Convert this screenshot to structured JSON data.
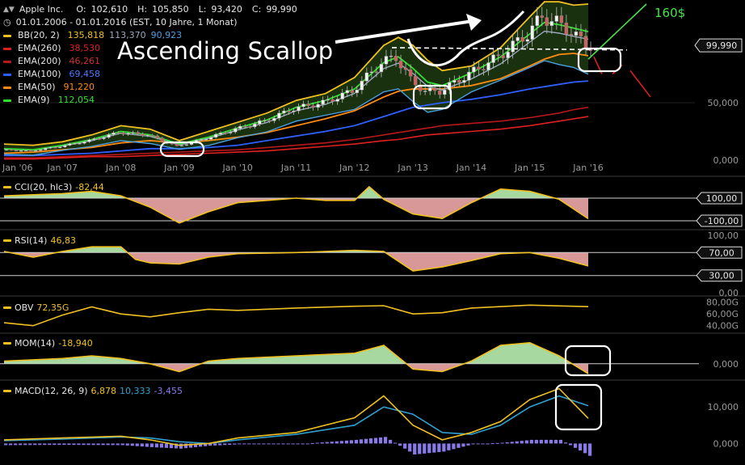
{
  "header": {
    "symbol": "Apple Inc.",
    "ohlc": [
      {
        "label": "O:",
        "value": "102,610"
      },
      {
        "label": "H:",
        "value": "105,850"
      },
      {
        "label": "L:",
        "value": "93,420"
      },
      {
        "label": "C:",
        "value": "99,990"
      }
    ],
    "period": "01.01.2006 - 01.01.2016 (EST, 10 Jahre, 1 Monat)",
    "indicators": [
      {
        "name": "BB(20, 2)",
        "values": [
          "135,818",
          "113,370",
          "90,923"
        ],
        "color": "#f0c020",
        "value_colors": [
          "#f0c020",
          "#9aa8c0",
          "#4aa0e0"
        ]
      },
      {
        "name": "EMA(260)",
        "values": [
          "38,530"
        ],
        "color": "#e02020"
      },
      {
        "name": "EMA(200)",
        "values": [
          "46,261"
        ],
        "color": "#b81818"
      },
      {
        "name": "EMA(100)",
        "values": [
          "69,458"
        ],
        "color": "#2f5fff"
      },
      {
        "name": "EMA(50)",
        "values": [
          "91,220"
        ],
        "color": "#ff8c10"
      },
      {
        "name": "EMA(9)",
        "values": [
          "112,054"
        ],
        "color": "#30e030"
      }
    ]
  },
  "annotations": {
    "pattern": "Ascending Scallop",
    "target": "160$",
    "price_tag": "99,990"
  },
  "colors": {
    "background": "#000000",
    "bb_band": "#f0c020",
    "bb_fill": "#1f3a12",
    "bb_mid": "#9aa8c0",
    "ema9": "#30e030",
    "ema50": "#ff8c10",
    "ema100": "#2f5fff",
    "ema200": "#b81818",
    "ema260": "#e02020",
    "bb_lower": "#4aa0e0",
    "osc_line": "#f0c020",
    "osc_pos_fill": "#b8f0b0",
    "osc_neg_fill": "#f0a8a8",
    "macd_signal": "#30a0d0",
    "macd_hist": "#8a7ae8",
    "trend_green": "#49e04a",
    "trend_red": "#e02020"
  },
  "chart_data": [
    {
      "type": "line",
      "title": "Apple Inc.",
      "panel": "price",
      "x_ticks": [
        "Jan '06",
        "Jan '07",
        "Jan '08",
        "Jan '09",
        "Jan '10",
        "Jan '11",
        "Jan '12",
        "Jan '13",
        "Jan '14",
        "Jan '15",
        "Jan '16"
      ],
      "y_ticks": [
        "50,000",
        "0,000"
      ],
      "ylim": [
        0,
        140
      ],
      "x": [
        2006.0,
        2006.5,
        2007.0,
        2007.5,
        2008.0,
        2008.5,
        2009.0,
        2009.5,
        2010.0,
        2010.5,
        2011.0,
        2011.5,
        2012.0,
        2012.5,
        2012.75,
        2013.0,
        2013.25,
        2013.5,
        2014.0,
        2014.5,
        2015.0,
        2015.25,
        2015.5,
        2015.75,
        2016.0
      ],
      "series": [
        {
          "name": "Price",
          "values": [
            9,
            8,
            12,
            17,
            24,
            22,
            12,
            19,
            27,
            34,
            45,
            50,
            60,
            85,
            90,
            70,
            60,
            60,
            75,
            90,
            110,
            125,
            120,
            112,
            100
          ]
        },
        {
          "name": "BB(20, 2)",
          "values": [
            14,
            13,
            16,
            22,
            30,
            27,
            17,
            25,
            33,
            41,
            52,
            58,
            72,
            100,
            107,
            100,
            87,
            78,
            82,
            98,
            125,
            138,
            138,
            135,
            136
          ]
        },
        {
          "name": "EMA(9)",
          "values": [
            10,
            9,
            13,
            18,
            25,
            22,
            14,
            20,
            28,
            35,
            46,
            52,
            62,
            85,
            90,
            80,
            68,
            65,
            76,
            90,
            110,
            120,
            118,
            115,
            112
          ]
        },
        {
          "name": "EMA(50)",
          "values": [
            6,
            7,
            9,
            11,
            15,
            17,
            15,
            17,
            20,
            24,
            30,
            36,
            43,
            55,
            60,
            62,
            62,
            62,
            65,
            71,
            82,
            88,
            92,
            93,
            91
          ]
        },
        {
          "name": "EMA(100)",
          "values": [
            4,
            4,
            5,
            6,
            8,
            10,
            10,
            11,
            13,
            17,
            21,
            25,
            30,
            38,
            42,
            46,
            48,
            50,
            53,
            57,
            62,
            64,
            66,
            68,
            69
          ]
        },
        {
          "name": "EMA(200)",
          "values": [
            2,
            2,
            3,
            4,
            5,
            6,
            7,
            8,
            9,
            11,
            13,
            15,
            18,
            22,
            24,
            26,
            28,
            30,
            32,
            34,
            37,
            39,
            41,
            44,
            46
          ]
        },
        {
          "name": "EMA(260)",
          "values": [
            1,
            1,
            2,
            3,
            3,
            4,
            5,
            6,
            7,
            8,
            10,
            12,
            14,
            17,
            18,
            20,
            22,
            23,
            25,
            27,
            30,
            32,
            34,
            36,
            38
          ]
        }
      ]
    },
    {
      "type": "area",
      "panel": "CCI",
      "series": [
        {
          "name": "CCI(20, hlc3)",
          "value_label": "-82,44"
        }
      ],
      "y_ticks": [
        "100,00",
        "-100,00"
      ],
      "ylim": [
        -150,
        250
      ],
      "x": [
        2006.0,
        2007.0,
        2007.5,
        2008.0,
        2008.5,
        2009.0,
        2009.5,
        2010.0,
        2010.5,
        2011.0,
        2011.5,
        2012.0,
        2012.25,
        2012.5,
        2013.0,
        2013.5,
        2014.0,
        2014.5,
        2015.0,
        2015.5,
        2016.0
      ],
      "values": [
        120,
        140,
        160,
        120,
        20,
        -120,
        -20,
        60,
        80,
        100,
        80,
        80,
        200,
        90,
        -40,
        -80,
        60,
        180,
        160,
        90,
        -82.44
      ]
    },
    {
      "type": "area",
      "panel": "RSI",
      "series": [
        {
          "name": "RSI(14)",
          "value_label": "46,83"
        }
      ],
      "y_ticks": [
        "100,00",
        "70,00",
        "30,00",
        "0,00"
      ],
      "ylim": [
        0,
        100
      ],
      "x": [
        2006.0,
        2006.5,
        2007.0,
        2007.5,
        2008.0,
        2008.25,
        2008.5,
        2009.0,
        2009.5,
        2010.0,
        2011.0,
        2012.0,
        2012.5,
        2013.0,
        2013.5,
        2014.0,
        2014.5,
        2015.0,
        2015.5,
        2016.0
      ],
      "values": [
        72,
        62,
        72,
        80,
        80,
        58,
        52,
        50,
        62,
        68,
        70,
        74,
        72,
        38,
        45,
        56,
        68,
        70,
        60,
        46.83
      ]
    },
    {
      "type": "line",
      "panel": "OBV",
      "series": [
        {
          "name": "OBV",
          "value_label": "72,35G"
        }
      ],
      "y_ticks": [
        "80,00G",
        "60,00G",
        "40,00G"
      ],
      "ylim": [
        30,
        85
      ],
      "x": [
        2006.0,
        2006.5,
        2007.0,
        2007.5,
        2008.0,
        2008.5,
        2009.0,
        2009.5,
        2010.0,
        2011.0,
        2012.0,
        2012.5,
        2013.0,
        2013.5,
        2014.0,
        2015.0,
        2016.0
      ],
      "values": [
        45,
        40,
        58,
        72,
        60,
        55,
        62,
        68,
        66,
        70,
        73,
        74,
        60,
        62,
        70,
        75,
        72.35
      ]
    },
    {
      "type": "area",
      "panel": "MOM",
      "series": [
        {
          "name": "MOM(14)",
          "value_label": "-18,940"
        }
      ],
      "y_ticks": [
        "0,000"
      ],
      "ylim": [
        -25,
        55
      ],
      "x": [
        2006.0,
        2007.0,
        2007.5,
        2008.0,
        2008.5,
        2009.0,
        2009.5,
        2010.0,
        2011.0,
        2012.0,
        2012.5,
        2013.0,
        2013.5,
        2014.0,
        2014.5,
        2015.0,
        2015.5,
        2016.0
      ],
      "values": [
        5,
        10,
        15,
        10,
        0,
        -15,
        5,
        10,
        15,
        20,
        35,
        -10,
        -15,
        5,
        35,
        40,
        15,
        -18.94
      ]
    },
    {
      "type": "line",
      "panel": "MACD",
      "series": [
        {
          "name": "MACD(12, 26, 9)",
          "value_label": "6,878"
        },
        {
          "name": "Signal",
          "value_label": "10,333"
        },
        {
          "name": "Histogram",
          "value_label": "-3,455"
        }
      ],
      "y_ticks": [
        "10,000",
        "0,000"
      ],
      "ylim": [
        -3,
        16
      ],
      "x": [
        2006.0,
        2007.0,
        2008.0,
        2008.5,
        2009.0,
        2009.5,
        2010.0,
        2011.0,
        2012.0,
        2012.5,
        2013.0,
        2013.5,
        2014.0,
        2014.5,
        2015.0,
        2015.5,
        2016.0
      ],
      "macd": [
        1,
        1.5,
        2,
        1,
        -0.5,
        0,
        1.5,
        3,
        7,
        13,
        5,
        1,
        3,
        6,
        12,
        15,
        6.878
      ],
      "signal": [
        0.8,
        1.2,
        1.8,
        1.5,
        0.5,
        0,
        1,
        2.5,
        5,
        10,
        8,
        3,
        2.5,
        5,
        10,
        13,
        10.333
      ]
    }
  ]
}
